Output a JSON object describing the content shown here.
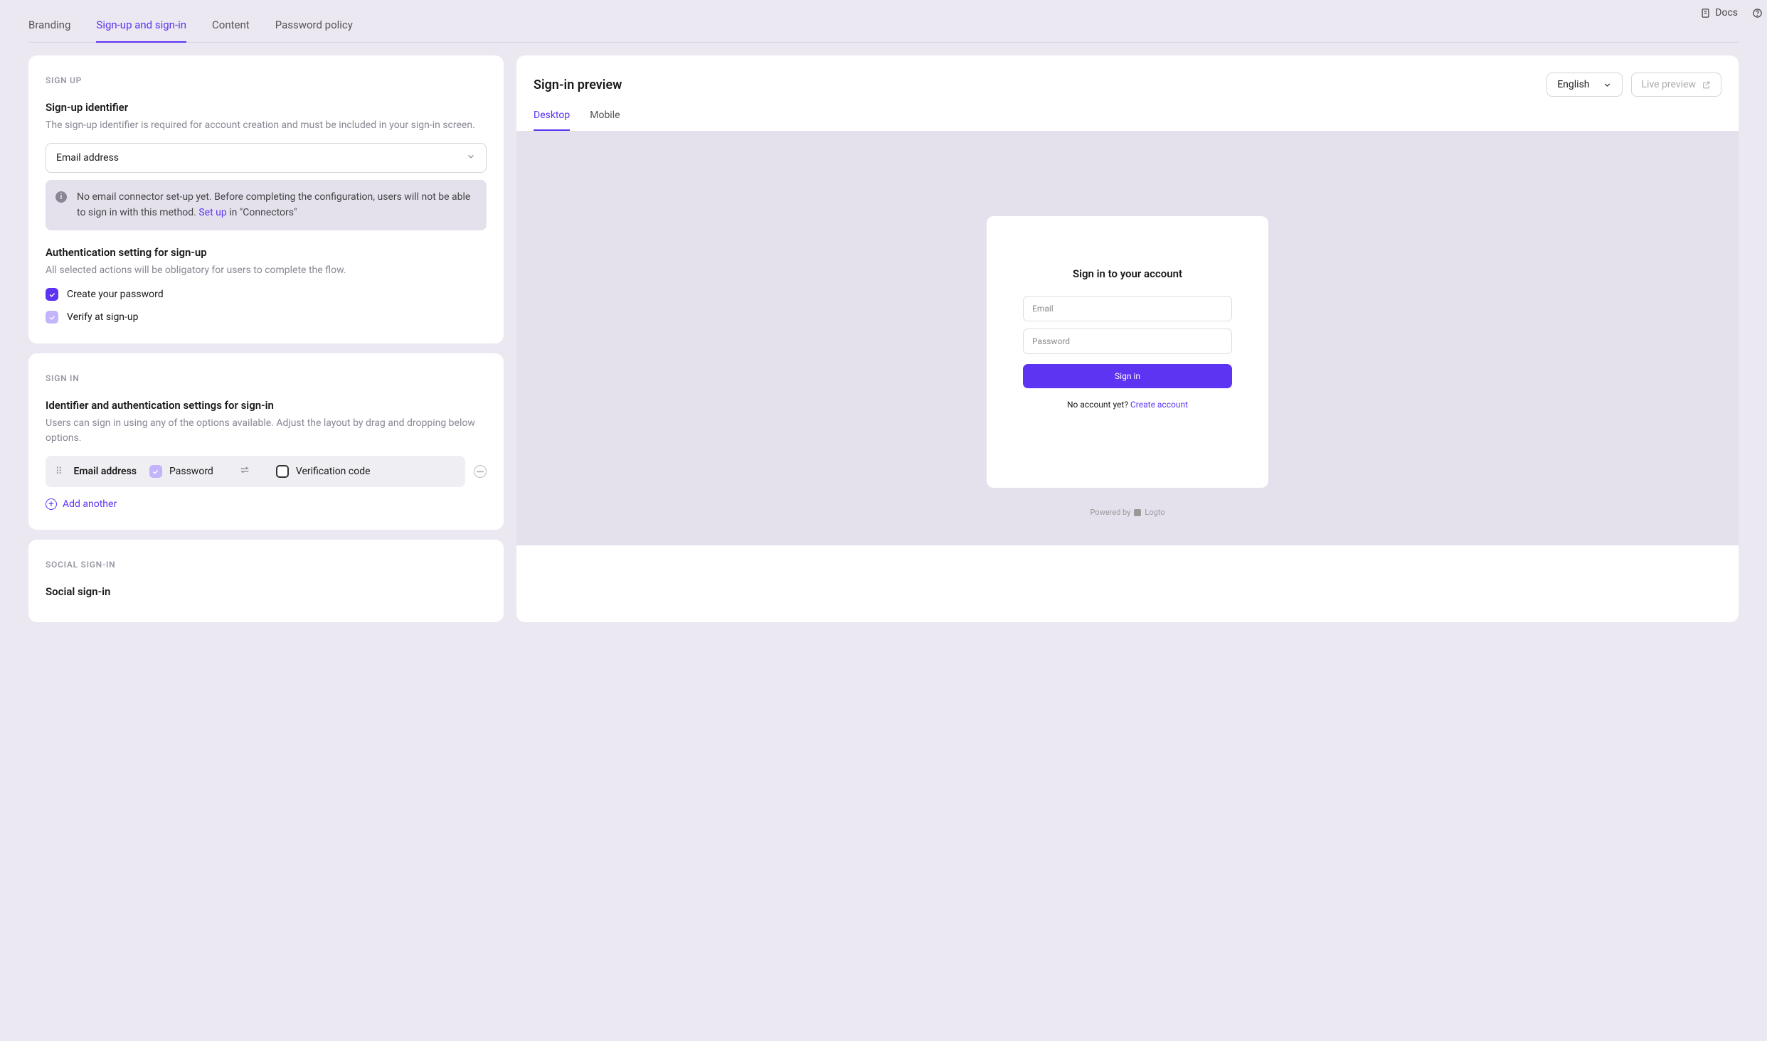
{
  "header": {
    "docs_label": "Docs"
  },
  "tabs": [
    "Branding",
    "Sign-up and sign-in",
    "Content",
    "Password policy"
  ],
  "active_tab": 1,
  "sign_up": {
    "section": "Sign up",
    "identifier": {
      "title": "Sign-up identifier",
      "desc": "The sign-up identifier is required for account creation and must be included in your sign-in screen.",
      "selected": "Email address",
      "alert_pre": "No email connector set-up yet. Before completing the configuration, users will not be able to sign in with this method. ",
      "alert_link": "Set up",
      "alert_post": " in \"Connectors\""
    },
    "auth": {
      "title": "Authentication setting for sign-up",
      "desc": "All selected actions will be obligatory for users to complete the flow.",
      "create_password": "Create your password",
      "verify": "Verify at sign-up"
    }
  },
  "sign_in": {
    "section": "Sign in",
    "title": "Identifier and authentication settings for sign-in",
    "desc": "Users can sign in using any of the options available. Adjust the layout by drag and dropping below options.",
    "row": {
      "identifier": "Email address",
      "password": "Password",
      "verification_code": "Verification code"
    },
    "add_another": "Add another"
  },
  "social": {
    "section": "Social sign-in",
    "title": "Social sign-in"
  },
  "preview": {
    "title": "Sign-in preview",
    "language": "English",
    "live_preview": "Live preview",
    "tabs": [
      "Desktop",
      "Mobile"
    ],
    "active": 0,
    "box": {
      "title": "Sign in to your account",
      "email_ph": "Email",
      "password_ph": "Password",
      "button": "Sign in",
      "no_account": "No account yet? ",
      "create": "Create account"
    },
    "powered_by": "Powered by",
    "brand": "Logto"
  }
}
